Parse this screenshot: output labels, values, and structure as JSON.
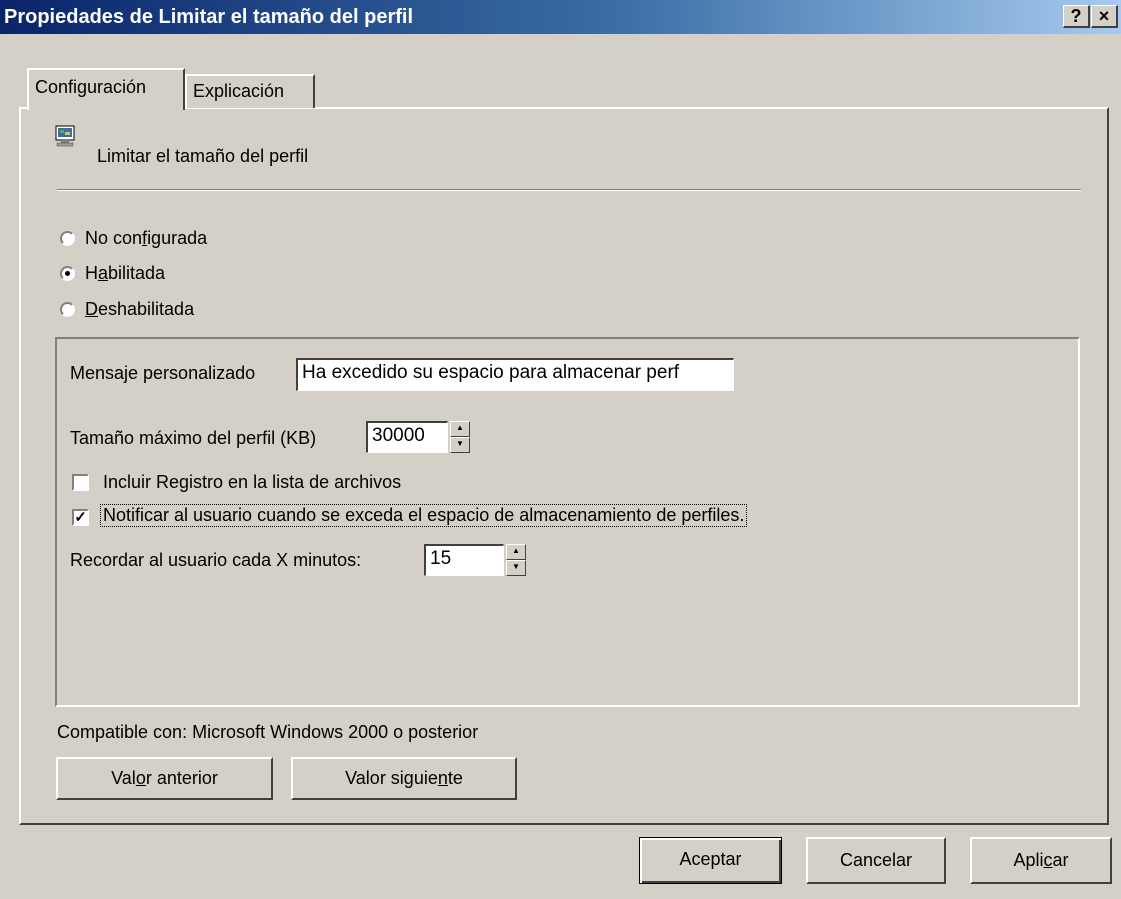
{
  "window": {
    "title": "Propiedades de Limitar el tamaño del perfil",
    "help_glyph": "?",
    "close_glyph": "×"
  },
  "tabs": [
    {
      "label": "Configuración"
    },
    {
      "label": "Explicación"
    }
  ],
  "policy": {
    "icon": "policy-icon",
    "name": "Limitar el tamaño del perfil"
  },
  "state": {
    "selected": "Habilitada",
    "options": [
      {
        "pre": "No con",
        "u": "f",
        "post": "igurada"
      },
      {
        "pre": "H",
        "u": "a",
        "post": "bilitada"
      },
      {
        "pre": "",
        "u": "D",
        "post": "eshabilitada"
      }
    ]
  },
  "options": {
    "message_label": "Mensaje personalizado",
    "message_value": "Ha excedido su espacio para almacenar perf",
    "max_size_label": "Tamaño máximo del perfil (KB)",
    "max_size_value": "30000",
    "include_registry_label": "Incluir Registro en la lista de archivos",
    "include_registry_checked": false,
    "notify_label": "Notificar al usuario cuando se exceda el espacio de almacenamiento de perfiles.",
    "notify_checked": true,
    "remind_label": "Recordar al usuario cada X minutos:",
    "remind_value": "15"
  },
  "compatibility": "Compatible con: Microsoft Windows 2000 o posterior",
  "nav_buttons": {
    "prev": {
      "pre": "Val",
      "u": "o",
      "post": "r anterior"
    },
    "next": {
      "pre": "Valor siguie",
      "u": "n",
      "post": "te"
    }
  },
  "dialog_buttons": {
    "ok": "Aceptar",
    "cancel": "Cancelar",
    "apply": {
      "pre": "Apli",
      "u": "c",
      "post": "ar"
    }
  }
}
